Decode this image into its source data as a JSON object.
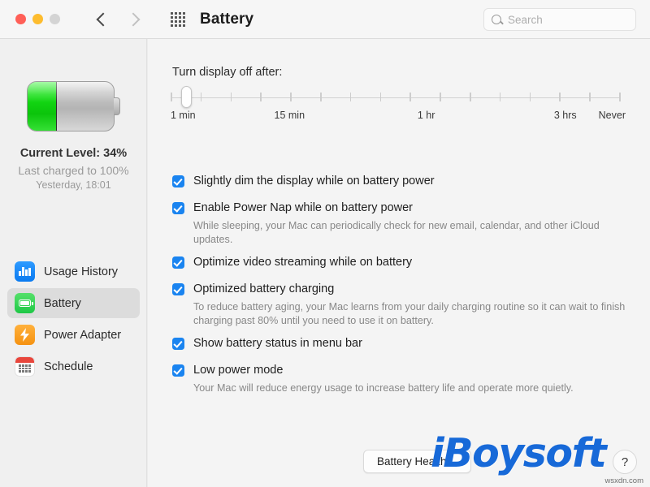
{
  "window": {
    "title": "Battery",
    "traffic_lights": [
      "close",
      "minimize",
      "zoom"
    ],
    "back_label": "Back",
    "forward_label": "Forward",
    "grid_label": "Show All"
  },
  "search": {
    "placeholder": "Search",
    "value": ""
  },
  "sidebar": {
    "battery": {
      "level_percent": 34,
      "current_level": "Current Level: 34%",
      "last_charged": "Last charged to 100%",
      "charge_time": "Yesterday, 18:01"
    },
    "items": [
      {
        "label": "Usage History",
        "icon": "usage-history-icon",
        "selected": false
      },
      {
        "label": "Battery",
        "icon": "battery-icon",
        "selected": true
      },
      {
        "label": "Power Adapter",
        "icon": "power-adapter-icon",
        "selected": false
      },
      {
        "label": "Schedule",
        "icon": "schedule-icon",
        "selected": false
      }
    ]
  },
  "main": {
    "slider": {
      "label": "Turn display off after:",
      "tick_count": 16,
      "knob_position_percent": 3.5,
      "tick_labels": [
        {
          "text": "1 min",
          "pos_percent": 0
        },
        {
          "text": "15 min",
          "pos_percent": 26.5
        },
        {
          "text": "1 hr",
          "pos_percent": 57
        },
        {
          "text": "3 hrs",
          "pos_percent": 88
        },
        {
          "text": "Never",
          "pos_percent": 100
        }
      ]
    },
    "annotation": {
      "type": "arrow-right",
      "color": "#23a493"
    },
    "options": [
      {
        "label": "Slightly dim the display while on battery power",
        "checked": true,
        "description": ""
      },
      {
        "label": "Enable Power Nap while on battery power",
        "checked": true,
        "description": "While sleeping, your Mac can periodically check for new email, calendar, and other iCloud updates."
      },
      {
        "label": "Optimize video streaming while on battery",
        "checked": true,
        "description": ""
      },
      {
        "label": "Optimized battery charging",
        "checked": true,
        "description": "To reduce battery aging, your Mac learns from your daily charging routine so it can wait to finish charging past 80% until you need to use it on battery."
      },
      {
        "label": "Show battery status in menu bar",
        "checked": true,
        "description": ""
      },
      {
        "label": "Low power mode",
        "checked": true,
        "description": "Your Mac will reduce energy usage to increase battery life and operate more quietly."
      }
    ],
    "footer": {
      "battery_health_button": "Battery Health…",
      "help_button": "?"
    }
  },
  "watermark": {
    "brand": "iBoysoft",
    "site": "wsxdn.com"
  },
  "colors": {
    "checkbox_blue": "#1a84f0",
    "annotation_teal": "#23a493",
    "battery_green": "#0bc40b",
    "selection_gray": "#dcdcdc"
  }
}
